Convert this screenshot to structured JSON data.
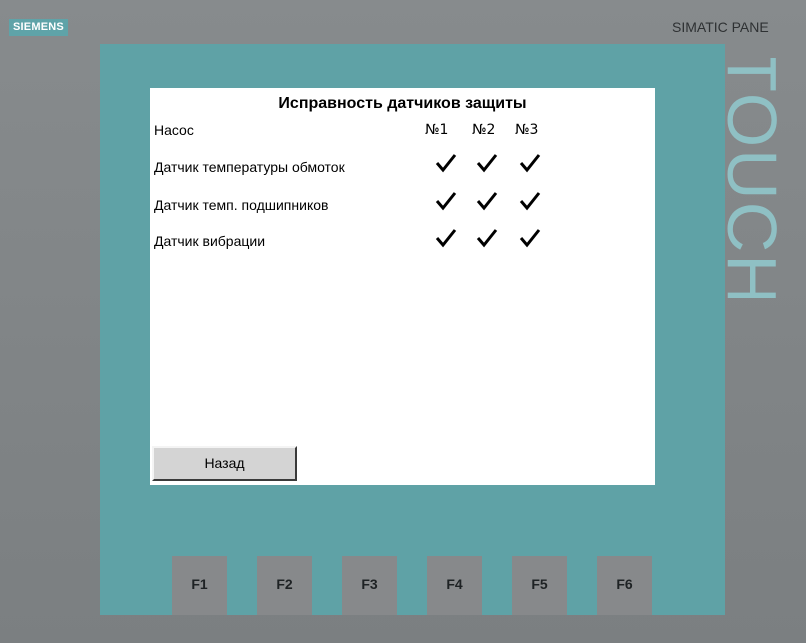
{
  "device": {
    "brand": "SIEMENS",
    "model": "SIMATIC PANE",
    "bezel_text": "TOUCH"
  },
  "screen": {
    "title": "Исправность датчиков защиты",
    "row_header": "Насос",
    "columns": [
      "№1",
      "№2",
      "№3"
    ],
    "rows": [
      {
        "label": "Датчик температуры обмоток",
        "checks": [
          true,
          true,
          true
        ]
      },
      {
        "label": "Датчик темп. подшипников",
        "checks": [
          true,
          true,
          true
        ]
      },
      {
        "label": "Датчик вибрации",
        "checks": [
          true,
          true,
          true
        ]
      }
    ],
    "back_label": "Назад"
  },
  "function_keys": [
    "F1",
    "F2",
    "F3",
    "F4",
    "F5",
    "F6"
  ],
  "colors": {
    "bezel": "#5fa2a6",
    "housing": "#7e8284",
    "screen_bg": "#ffffff",
    "fkey": "#87898b"
  }
}
